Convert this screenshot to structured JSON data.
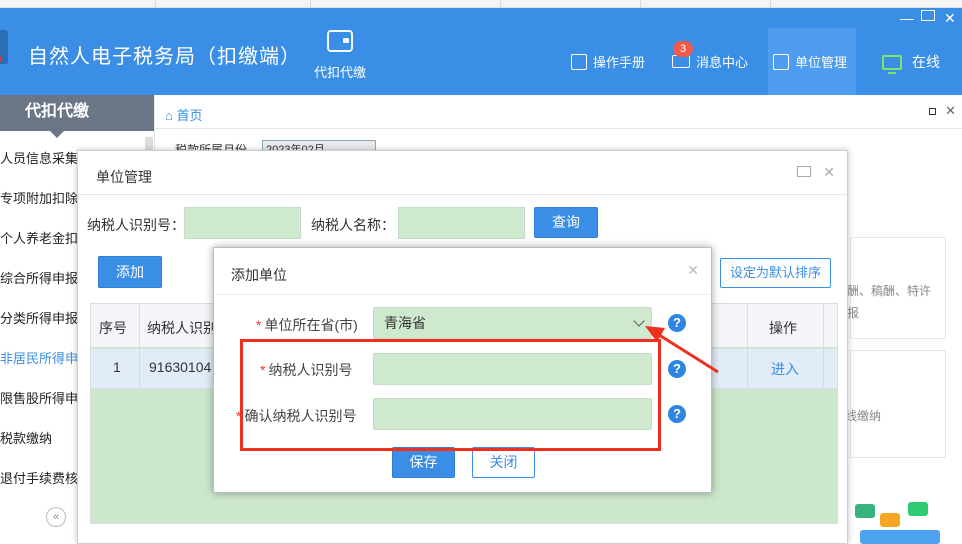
{
  "header": {
    "app_title": "自然人电子税务局（扣缴端）",
    "nav_withhold": "代扣代缴",
    "manual": "操作手册",
    "messages": "消息中心",
    "message_count": "3",
    "unit_mgmt": "单位管理",
    "online": "在线",
    "colors": {
      "brand": "#3a8ee6",
      "online": "#7be56b",
      "badge": "#f25a4b"
    }
  },
  "sidebar": {
    "title": "代扣代缴",
    "items": [
      {
        "label": "人员信息采集"
      },
      {
        "label": "专项附加扣除"
      },
      {
        "label": "个人养老金扣"
      },
      {
        "label": "综合所得申报"
      },
      {
        "label": "分类所得申报"
      },
      {
        "label": "非居民所得申"
      },
      {
        "label": "限售股所得申"
      },
      {
        "label": "税款缴纳"
      },
      {
        "label": "退付手续费核"
      }
    ],
    "collapse_icon": "«"
  },
  "breadcrumb": {
    "home": "首页"
  },
  "background": {
    "period_label": "税款所属月份",
    "period_value": "2023年02月",
    "card_text_1": "酬、稿酬、特许",
    "card_text_2": "报",
    "card_text_3": "线缴纳"
  },
  "unit_dialog": {
    "title": "单位管理",
    "taxpayer_id_label": "纳税人识别号：",
    "taxpayer_name_label": "纳税人名称：",
    "query": "查询",
    "add": "添加",
    "set_default": "设定为默认排序",
    "columns": [
      "序号",
      "纳税人识别",
      "操作"
    ],
    "rows": [
      {
        "index": "1",
        "tax_id": "91630104",
        "action": "进入"
      }
    ]
  },
  "add_dialog": {
    "title": "添加单位",
    "province_label": "单位所在省(市)",
    "province_value": "青海省",
    "taxpayer_id_label": "纳税人识别号",
    "confirm_id_label": "确认纳税人识别号",
    "required_mark": "*",
    "help_icon": "?",
    "save": "保存",
    "close": "关闭"
  },
  "annotation": {
    "color": "#f0301f"
  }
}
